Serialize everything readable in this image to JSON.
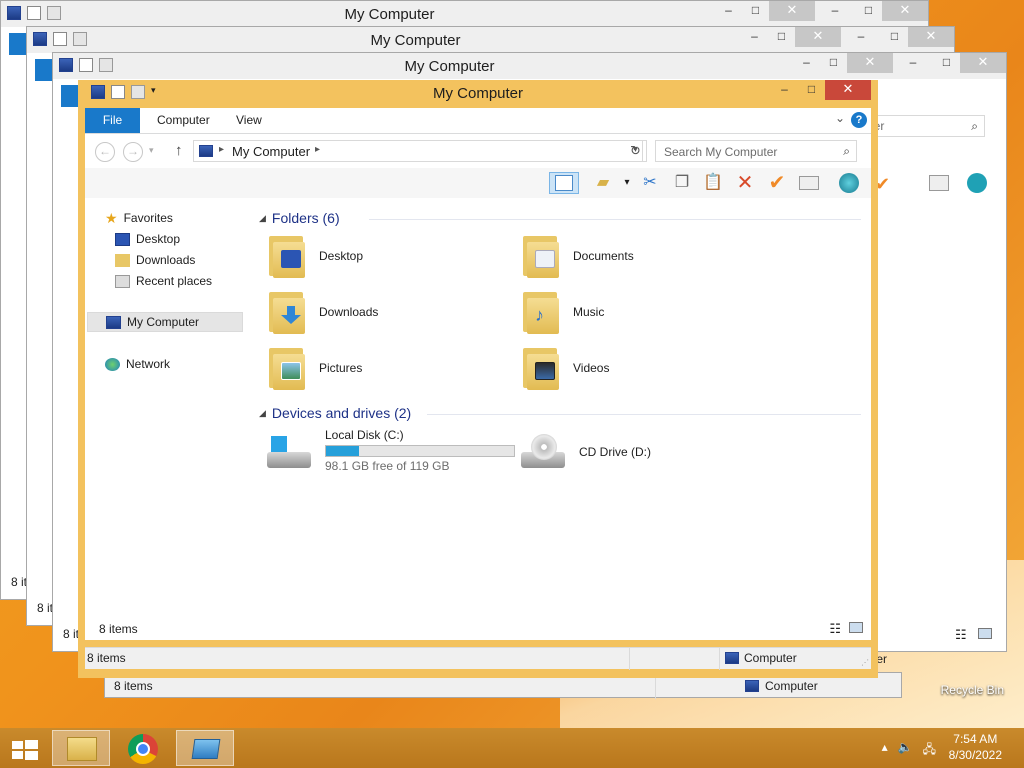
{
  "window": {
    "title": "My Computer",
    "tabs": {
      "file": "File",
      "computer": "Computer",
      "view": "View"
    },
    "help": "?",
    "address": {
      "path": "My Computer"
    },
    "search": {
      "placeholder": "Search My Computer"
    },
    "bg_search_fragment": "puter"
  },
  "nav": {
    "favorites": "Favorites",
    "desktop": "Desktop",
    "downloads": "Downloads",
    "recent": "Recent places",
    "computer": "My Computer",
    "network": "Network"
  },
  "groups": {
    "folders": "Folders (6)",
    "devices": "Devices and drives (2)"
  },
  "folders": [
    "Desktop",
    "Documents",
    "Downloads",
    "Music",
    "Pictures",
    "Videos"
  ],
  "drives": {
    "c": {
      "name": "Local Disk (C:)",
      "free": "98.1 GB free of 119 GB",
      "used_fraction": 0.176
    },
    "d": {
      "name": "CD Drive (D:)"
    }
  },
  "status": {
    "items": "8 items",
    "location": "Computer",
    "bg_location_fragment": "omputer"
  },
  "taskbar": {
    "time": "7:54 AM",
    "date": "8/30/2022"
  },
  "desktop": {
    "recycle": "Recycle Bin"
  },
  "colors": {
    "accent": "#1979ca",
    "frame": "#f3c25e",
    "progress": "#26a0da"
  }
}
